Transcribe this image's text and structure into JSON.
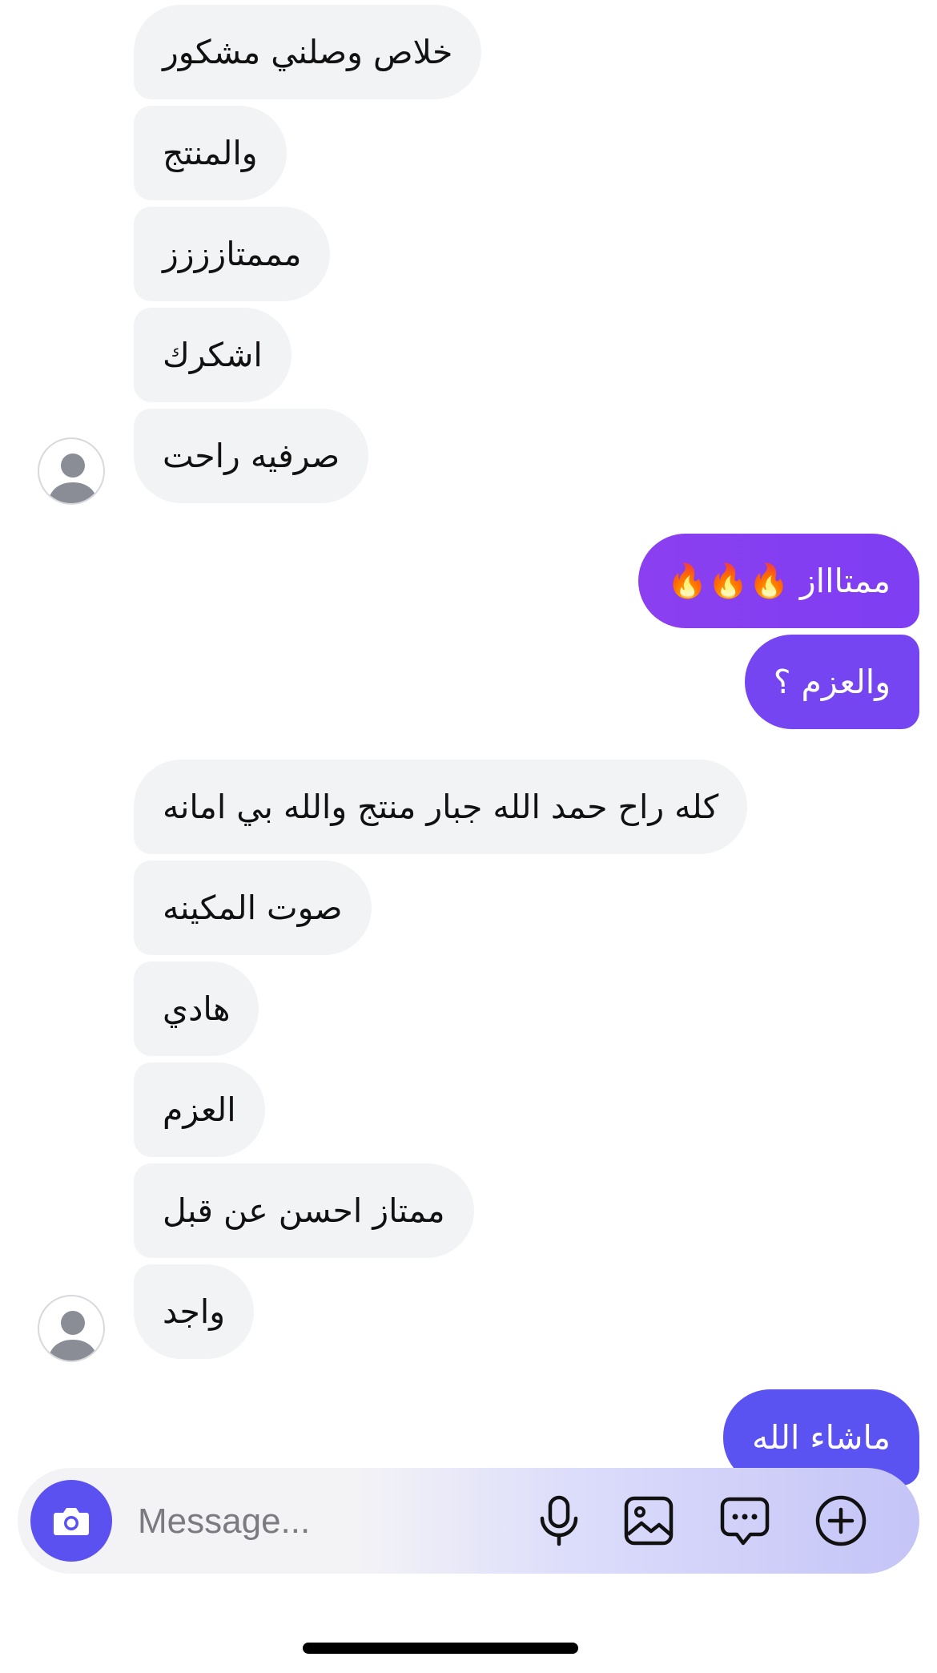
{
  "messages": {
    "group1": [
      "خلاص وصلني مشكور",
      "والمنتج",
      "مممتازززز",
      "اشكرك",
      "صرفيه راحت"
    ],
    "sent1": [
      "ممتاااز 🔥🔥🔥",
      "والعزم ؟"
    ],
    "group2": [
      "كله راح حمد الله جبار منتج والله بي امانه",
      "صوت المكينه",
      "هادي",
      "العزم",
      "ممتاز احسن عن قبل",
      "واجد"
    ],
    "sent2": [
      "ماشاء الله"
    ]
  },
  "composer": {
    "placeholder": "Message...",
    "icons": [
      "camera-icon",
      "microphone-icon",
      "gallery-icon",
      "sticker-icon",
      "add-icon"
    ]
  },
  "colors": {
    "incoming_bubble": "#f2f3f5",
    "outgoing_purple": "#7b3ff2",
    "outgoing_blue": "#5b50f0"
  }
}
